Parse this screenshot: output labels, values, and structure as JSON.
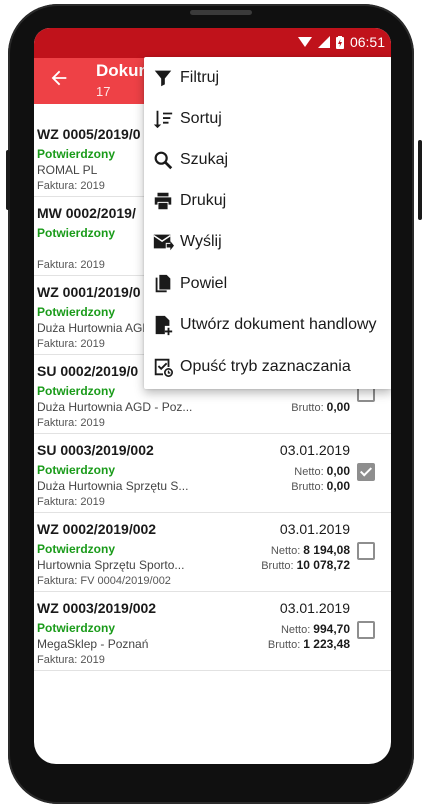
{
  "status_bar": {
    "time": "06:51"
  },
  "app_bar": {
    "title": "Dokum",
    "subtitle": "17"
  },
  "menu": {
    "items": [
      {
        "label": "Filtruj",
        "icon": "filter-icon"
      },
      {
        "label": "Sortuj",
        "icon": "sort-icon"
      },
      {
        "label": "Szukaj",
        "icon": "search-icon"
      },
      {
        "label": "Drukuj",
        "icon": "print-icon"
      },
      {
        "label": "Wyślij",
        "icon": "send-mail-icon"
      },
      {
        "label": "Powiel",
        "icon": "duplicate-icon"
      },
      {
        "label": "Utwórz dokument handlowy",
        "icon": "create-document-icon"
      },
      {
        "label": "Opuść tryb zaznaczania",
        "icon": "exit-selection-icon"
      }
    ]
  },
  "documents": {
    "netto_label": "Netto:",
    "brutto_label": "Brutto:",
    "rows": [
      {
        "number": "WZ 0005/2019/0",
        "date": "",
        "status": "Potwierdzony",
        "client": "ROMAL PL",
        "invoice": "Faktura: 2019",
        "netto": "",
        "brutto": "",
        "checked": false
      },
      {
        "number": "MW 0002/2019/",
        "date": "",
        "status": "Potwierdzony",
        "client": "",
        "invoice": "Faktura: 2019",
        "netto": "",
        "brutto": "",
        "checked": false
      },
      {
        "number": "WZ 0001/2019/0",
        "date": "",
        "status": "Potwierdzony",
        "client": "Duża Hurtownia AGD",
        "invoice": "Faktura: 2019",
        "netto": "",
        "brutto": "",
        "checked": false
      },
      {
        "number": "SU 0002/2019/0",
        "date": "",
        "status": "Potwierdzony",
        "client": "Duża Hurtownia AGD - Poz...",
        "invoice": "Faktura: 2019",
        "netto": "",
        "brutto": "0,00",
        "checked": false
      },
      {
        "number": "SU 0003/2019/002",
        "date": "03.01.2019",
        "status": "Potwierdzony",
        "client": "Duża Hurtownia Sprzętu S...",
        "invoice": "Faktura: 2019",
        "netto": "0,00",
        "brutto": "0,00",
        "checked": true
      },
      {
        "number": "WZ 0002/2019/002",
        "date": "03.01.2019",
        "status": "Potwierdzony",
        "client": "Hurtownia Sprzętu Sporto...",
        "invoice": "Faktura: FV 0004/2019/002",
        "netto": "8 194,08",
        "brutto": "10 078,72",
        "checked": false
      },
      {
        "number": "WZ 0003/2019/002",
        "date": "03.01.2019",
        "status": "Potwierdzony",
        "client": "MegaSklep - Poznań",
        "invoice": "Faktura: 2019",
        "netto": "994,70",
        "brutto": "1 223,48",
        "checked": false
      }
    ]
  }
}
